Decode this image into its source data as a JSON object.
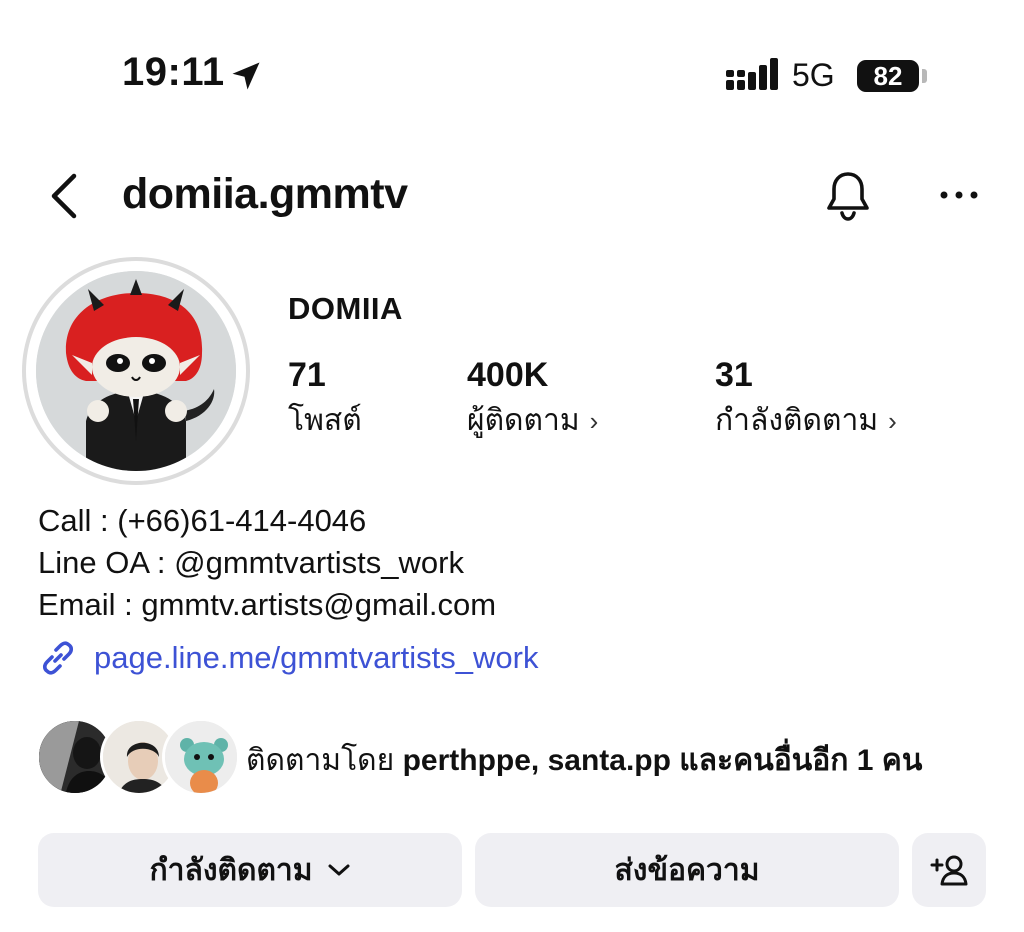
{
  "status_bar": {
    "time": "19:11",
    "network": "5G",
    "battery": "82",
    "icons": [
      "location-arrow-icon",
      "signal-icon",
      "battery-icon"
    ]
  },
  "header": {
    "username": "domiia.gmmtv",
    "icons": [
      "back-icon",
      "bell-icon",
      "more-icon"
    ]
  },
  "profile": {
    "display_name": "DOMIIA",
    "stats": [
      {
        "value": "71",
        "label": "โพสต์",
        "chevron": ""
      },
      {
        "value": "400K",
        "label": "ผู้ติดตาม",
        "chevron": "›"
      },
      {
        "value": "31",
        "label": "กำลังติดตาม",
        "chevron": "›"
      }
    ]
  },
  "bio": {
    "lines": [
      "Call : (+66)61-414-4046",
      "Line OA : @gmmtvartists_work",
      "Email : gmmtv.artists@gmail.com"
    ],
    "link": "page.line.me/gmmtvartists_work"
  },
  "followed_by": {
    "prefix": "ติดตามโดย",
    "users": "perthppe, santa.pp",
    "suffix": "และคนอื่นอีก 1 คน"
  },
  "actions": {
    "following_label": "กำลังติดตาม",
    "message_label": "ส่งข้อความ",
    "add_icon": "add-person-icon"
  },
  "colors": {
    "link": "#3d52d5",
    "button_bg": "#efeff3",
    "text": "#111111"
  }
}
